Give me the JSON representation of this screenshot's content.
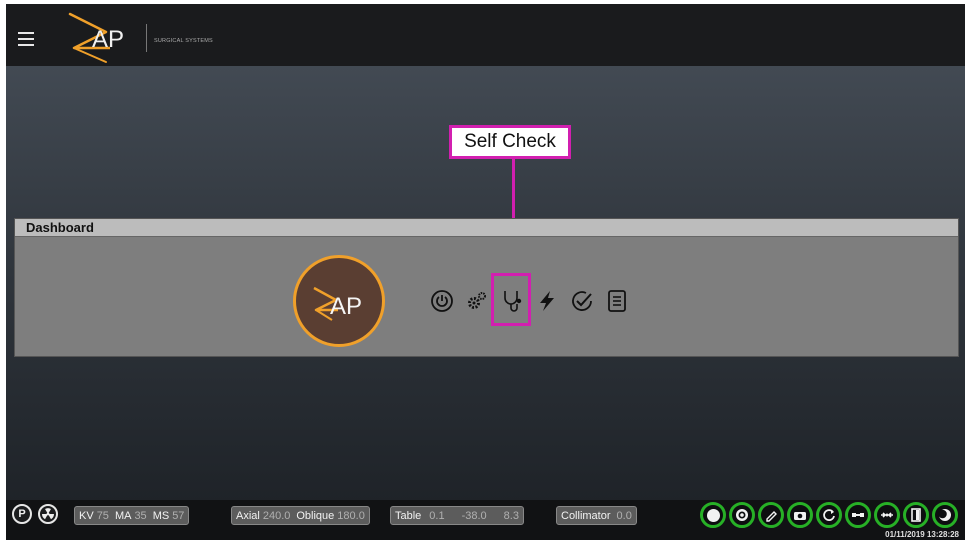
{
  "header": {
    "brand": "AP",
    "subtitle": "SURGICAL SYSTEMS"
  },
  "callout": {
    "label": "Self Check"
  },
  "dashboard": {
    "title": "Dashboard",
    "badge_text": "AP",
    "icons": [
      "power-icon",
      "gears-icon",
      "stethoscope-icon",
      "lightning-icon",
      "check-circle-icon",
      "document-icon"
    ]
  },
  "statusbar": {
    "p_button": "P",
    "kv_label": "KV",
    "kv_value": "75",
    "ma_label": "MA",
    "ma_value": "35",
    "ms_label": "MS",
    "ms_value": "57",
    "axial_label": "Axial",
    "axial_value": "240.0",
    "oblique_label": "Oblique",
    "oblique_value": "180.0",
    "table_label": "Table",
    "table_x": "0.1",
    "table_y": "-38.0",
    "table_z": "8.3",
    "collimator_label": "Collimator",
    "collimator_value": "0.0",
    "datetime": "01/11/2019 13:28:28",
    "right_buttons": [
      "head-icon",
      "target-icon",
      "pen-icon",
      "camera-icon",
      "refresh-icon",
      "satellite-icon",
      "arrows-in-icon",
      "door-icon",
      "moon-icon"
    ]
  },
  "colors": {
    "highlight": "#d21fb0",
    "accent_orange": "#f0a02a",
    "status_green": "#27b026"
  }
}
